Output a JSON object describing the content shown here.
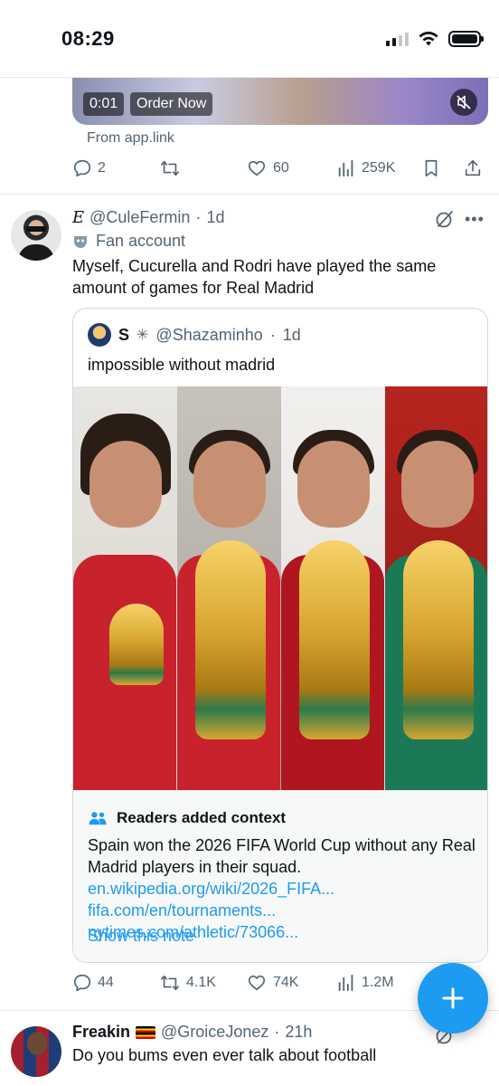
{
  "status_bar": {
    "time": "08:29"
  },
  "top_tweet": {
    "video_time": "0:01",
    "order_label": "Order Now",
    "from_link": "From app.link",
    "replies": "2",
    "likes": "60",
    "views": "259K"
  },
  "main_tweet": {
    "display_name": "E",
    "handle": "@CuleFermin",
    "time": "1d",
    "badge_label": "Fan account",
    "text": "Myself, Cucurella and Rodri have played the same amount of games for Real Madrid",
    "quote": {
      "name": "S",
      "handle": "@Shazaminho",
      "time": "1d",
      "text": "impossible without madrid"
    },
    "readers_context": {
      "title": "Readers added context",
      "body": "Spain won the 2026 FIFA World Cup without any Real Madrid players in their squad.",
      "links": "en.wikipedia.org/wiki/2026_FIFA... fifa.com/en/tournaments... nytimes.com/athletic/73066...",
      "show_note": "Show this note"
    },
    "replies": "44",
    "retweets": "4.1K",
    "likes": "74K",
    "views": "1.2M"
  },
  "bottom_tweet": {
    "display_name": "Freakin",
    "handle": "@GroiceJonez",
    "time": "21h",
    "text": "Do you bums even ever talk about football"
  },
  "colors": {
    "accent": "#1d9bf0",
    "text_primary": "#0f1419",
    "text_secondary": "#536471",
    "divider": "#e6e9ec"
  },
  "icons": [
    "signal-icon",
    "wifi-icon",
    "battery-icon",
    "mute-icon",
    "reply-icon",
    "retweet-icon",
    "like-icon",
    "views-icon",
    "bookmark-icon",
    "share-icon",
    "grok-icon",
    "more-icon",
    "fan-mask-icon",
    "web-icon",
    "readers-icon",
    "compose-icon"
  ]
}
